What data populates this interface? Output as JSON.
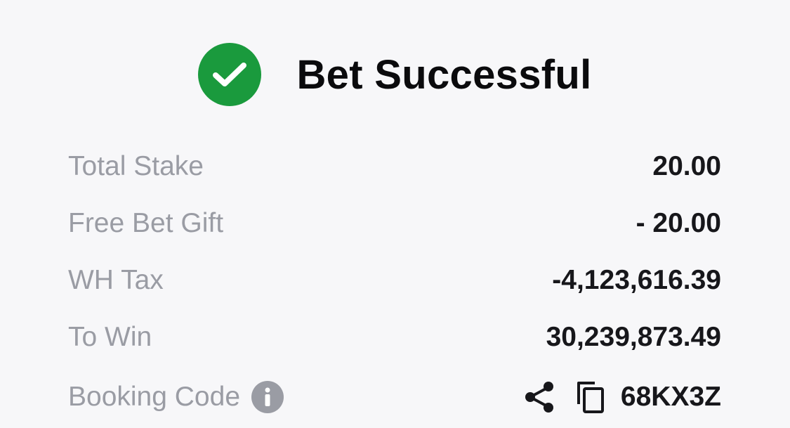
{
  "header": {
    "title": "Bet Successful",
    "icon": "check-circle-icon",
    "accent_color": "#1a9a3d"
  },
  "summary": {
    "total_stake": {
      "label": "Total Stake",
      "value": "20.00"
    },
    "free_bet_gift": {
      "label": "Free Bet Gift",
      "value": "- 20.00"
    },
    "wh_tax": {
      "label": "WH Tax",
      "value": "-4,123,616.39"
    },
    "to_win": {
      "label": "To Win",
      "value": "30,239,873.49"
    },
    "booking_code": {
      "label": "Booking Code",
      "value": "68KX3Z",
      "info_icon": "info-icon",
      "share_icon": "share-icon",
      "copy_icon": "copy-icon"
    }
  }
}
